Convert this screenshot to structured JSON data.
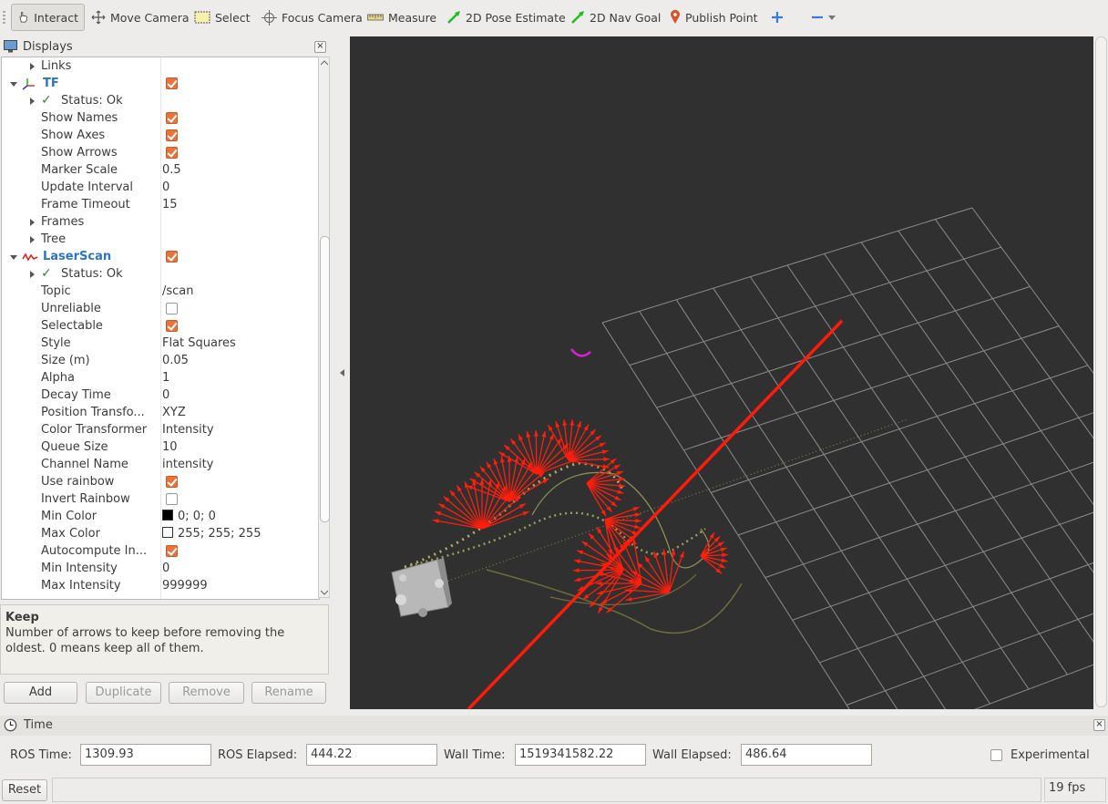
{
  "toolbar": {
    "tools": [
      {
        "label": "Interact",
        "icon": "hand-pointer-icon"
      },
      {
        "label": "Move Camera",
        "icon": "move-camera-icon"
      },
      {
        "label": "Select",
        "icon": "select-box-icon"
      },
      {
        "label": "Focus Camera",
        "icon": "focus-crosshair-icon"
      },
      {
        "label": "Measure",
        "icon": "ruler-icon"
      },
      {
        "label": "2D Pose Estimate",
        "icon": "green-arrow-icon"
      },
      {
        "label": "2D Nav Goal",
        "icon": "green-arrow-icon"
      },
      {
        "label": "Publish Point",
        "icon": "map-pin-icon"
      }
    ]
  },
  "displays": {
    "title": "Displays",
    "rows": [
      {
        "label": "Links"
      },
      {
        "label": "TF"
      },
      {
        "label": "Status: Ok"
      },
      {
        "label": "Show Names"
      },
      {
        "label": "Show Axes"
      },
      {
        "label": "Show Arrows"
      },
      {
        "label": "Marker Scale",
        "value": "0.5"
      },
      {
        "label": "Update Interval",
        "value": "0"
      },
      {
        "label": "Frame Timeout",
        "value": "15"
      },
      {
        "label": "Frames"
      },
      {
        "label": "Tree"
      },
      {
        "label": "LaserScan"
      },
      {
        "label": "Status: Ok"
      },
      {
        "label": "Topic",
        "value": "/scan"
      },
      {
        "label": "Unreliable"
      },
      {
        "label": "Selectable"
      },
      {
        "label": "Style",
        "value": "Flat Squares"
      },
      {
        "label": "Size (m)",
        "value": "0.05"
      },
      {
        "label": "Alpha",
        "value": "1"
      },
      {
        "label": "Decay Time",
        "value": "0"
      },
      {
        "label": "Position Transfo...",
        "value": "XYZ"
      },
      {
        "label": "Color Transformer",
        "value": "Intensity"
      },
      {
        "label": "Queue Size",
        "value": "10"
      },
      {
        "label": "Channel Name",
        "value": "intensity"
      },
      {
        "label": "Use rainbow"
      },
      {
        "label": "Invert Rainbow"
      },
      {
        "label": "Min Color",
        "value": "0; 0; 0"
      },
      {
        "label": "Max Color",
        "value": "255; 255; 255"
      },
      {
        "label": "Autocompute In..."
      },
      {
        "label": "Min Intensity",
        "value": "0"
      },
      {
        "label": "Max Intensity",
        "value": "999999"
      }
    ],
    "colors": {
      "min_color": "#000000",
      "max_color": "#ffffff",
      "checkbox_on": "#e8743c"
    }
  },
  "help": {
    "heading": "Keep",
    "text": "Number of arrows to keep before removing the oldest. 0 means keep all of them."
  },
  "buttons": {
    "add": "Add",
    "duplicate": "Duplicate",
    "remove": "Remove",
    "rename": "Rename"
  },
  "time": {
    "title": "Time",
    "ros_time_label": "ROS Time:",
    "ros_time": "1309.93",
    "ros_elapsed_label": "ROS Elapsed:",
    "ros_elapsed": "444.22",
    "wall_time_label": "Wall Time:",
    "wall_time": "1519341582.22",
    "wall_elapsed_label": "Wall Elapsed:",
    "wall_elapsed": "486.64",
    "experimental_label": "Experimental"
  },
  "status": {
    "reset_label": "Reset",
    "fps": "19 fps"
  },
  "viewport": {
    "background": "#303030",
    "grid_color": "#a0a0a0",
    "arrow_color": "#ff2a10",
    "path_color": "#8a8a55"
  }
}
